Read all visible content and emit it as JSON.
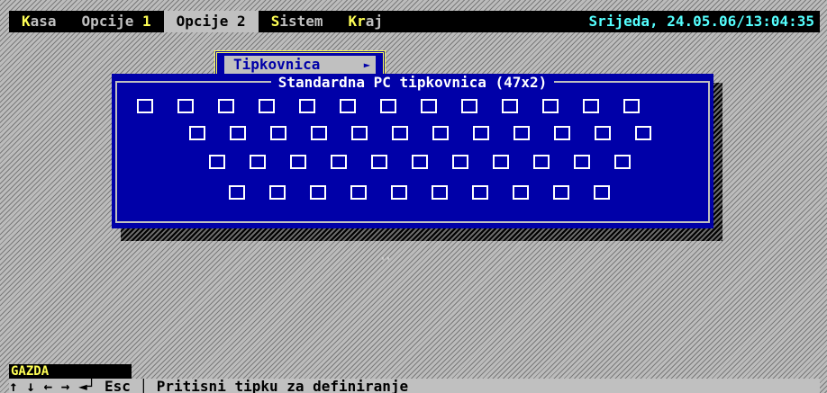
{
  "menubar": {
    "items": [
      {
        "hot": "K",
        "rest": "asa"
      },
      {
        "hot": "",
        "rest": "Opcije ",
        "hot2": "1"
      },
      {
        "hot": "",
        "rest": "Opcije 2"
      },
      {
        "hot": "S",
        "rest": "istem"
      },
      {
        "hot": "Kr",
        "rest": "aj"
      }
    ],
    "datetime": "Srijeda, 24.05.06/13:04:35"
  },
  "dropdown": {
    "selected_label": "Tipkovnica",
    "arrow": "►"
  },
  "dialog": {
    "title": "Standardna PC tipkovnica (47x2)",
    "rows": [
      13,
      12,
      11,
      10
    ]
  },
  "status": {
    "user": "GAZDA",
    "hint": "↑ ↓ ← → ◄┘ Esc │ Pritisni tipku za definiranje"
  },
  "colors": {
    "menu_bg": "#000000",
    "hotkey": "#ffff55",
    "datetime": "#55ffff",
    "dialog_bg": "#0000a8",
    "frame": "#c0c0c0"
  }
}
